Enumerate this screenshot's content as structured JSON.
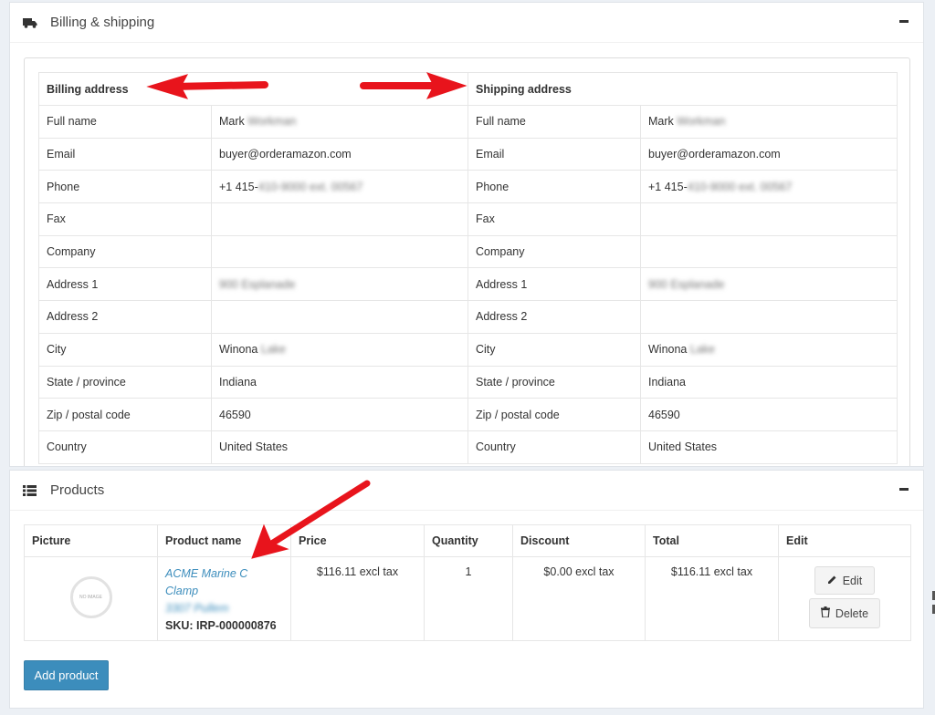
{
  "billing_panel": {
    "title": "Billing & shipping",
    "icon": "truck-icon",
    "collapse_icon": "minus-icon",
    "billing": {
      "heading": "Billing address",
      "rows": [
        {
          "label": "Full name",
          "value": "Mark Workman"
        },
        {
          "label": "Email",
          "value": "buyer@orderamazon.com"
        },
        {
          "label": "Phone",
          "value": "+1 415-410-9000 ext. 00567"
        },
        {
          "label": "Fax",
          "value": ""
        },
        {
          "label": "Company",
          "value": ""
        },
        {
          "label": "Address 1",
          "value": "900 Esplanade"
        },
        {
          "label": "Address 2",
          "value": ""
        },
        {
          "label": "City",
          "value": "Winona Lake"
        },
        {
          "label": "State / province",
          "value": "Indiana"
        },
        {
          "label": "Zip / postal code",
          "value": "46590"
        },
        {
          "label": "Country",
          "value": "United States"
        }
      ]
    },
    "shipping": {
      "heading": "Shipping address",
      "rows": [
        {
          "label": "Full name",
          "value": "Mark Workman"
        },
        {
          "label": "Email",
          "value": "buyer@orderamazon.com"
        },
        {
          "label": "Phone",
          "value": "+1 415-410-9000 ext. 00567"
        },
        {
          "label": "Fax",
          "value": ""
        },
        {
          "label": "Company",
          "value": ""
        },
        {
          "label": "Address 1",
          "value": "900 Esplanade"
        },
        {
          "label": "Address 2",
          "value": ""
        },
        {
          "label": "City",
          "value": "Winona Lake"
        },
        {
          "label": "State / province",
          "value": "Indiana"
        },
        {
          "label": "Zip / postal code",
          "value": "46590"
        },
        {
          "label": "Country",
          "value": "United States"
        }
      ]
    }
  },
  "products_panel": {
    "title": "Products",
    "icon": "list-icon",
    "collapse_icon": "minus-icon",
    "columns": [
      "Picture",
      "Product name",
      "Price",
      "Quantity",
      "Discount",
      "Total",
      "Edit"
    ],
    "rows": [
      {
        "picture_text": "NO IMAGE",
        "product_name_line1": "ACME Marine C Clamp",
        "product_name_line2": "3307 Pullem",
        "sku": "SKU: IRP-000000876",
        "price": "$116.11 excl tax",
        "quantity": "1",
        "discount": "$0.00 excl tax",
        "total": "$116.11 excl tax",
        "edit_label": "Edit",
        "delete_label": "Delete",
        "edit_icon": "pencil-icon",
        "delete_icon": "trash-icon"
      }
    ],
    "add_button": "Add product"
  },
  "annotation_color": "#e8141c"
}
